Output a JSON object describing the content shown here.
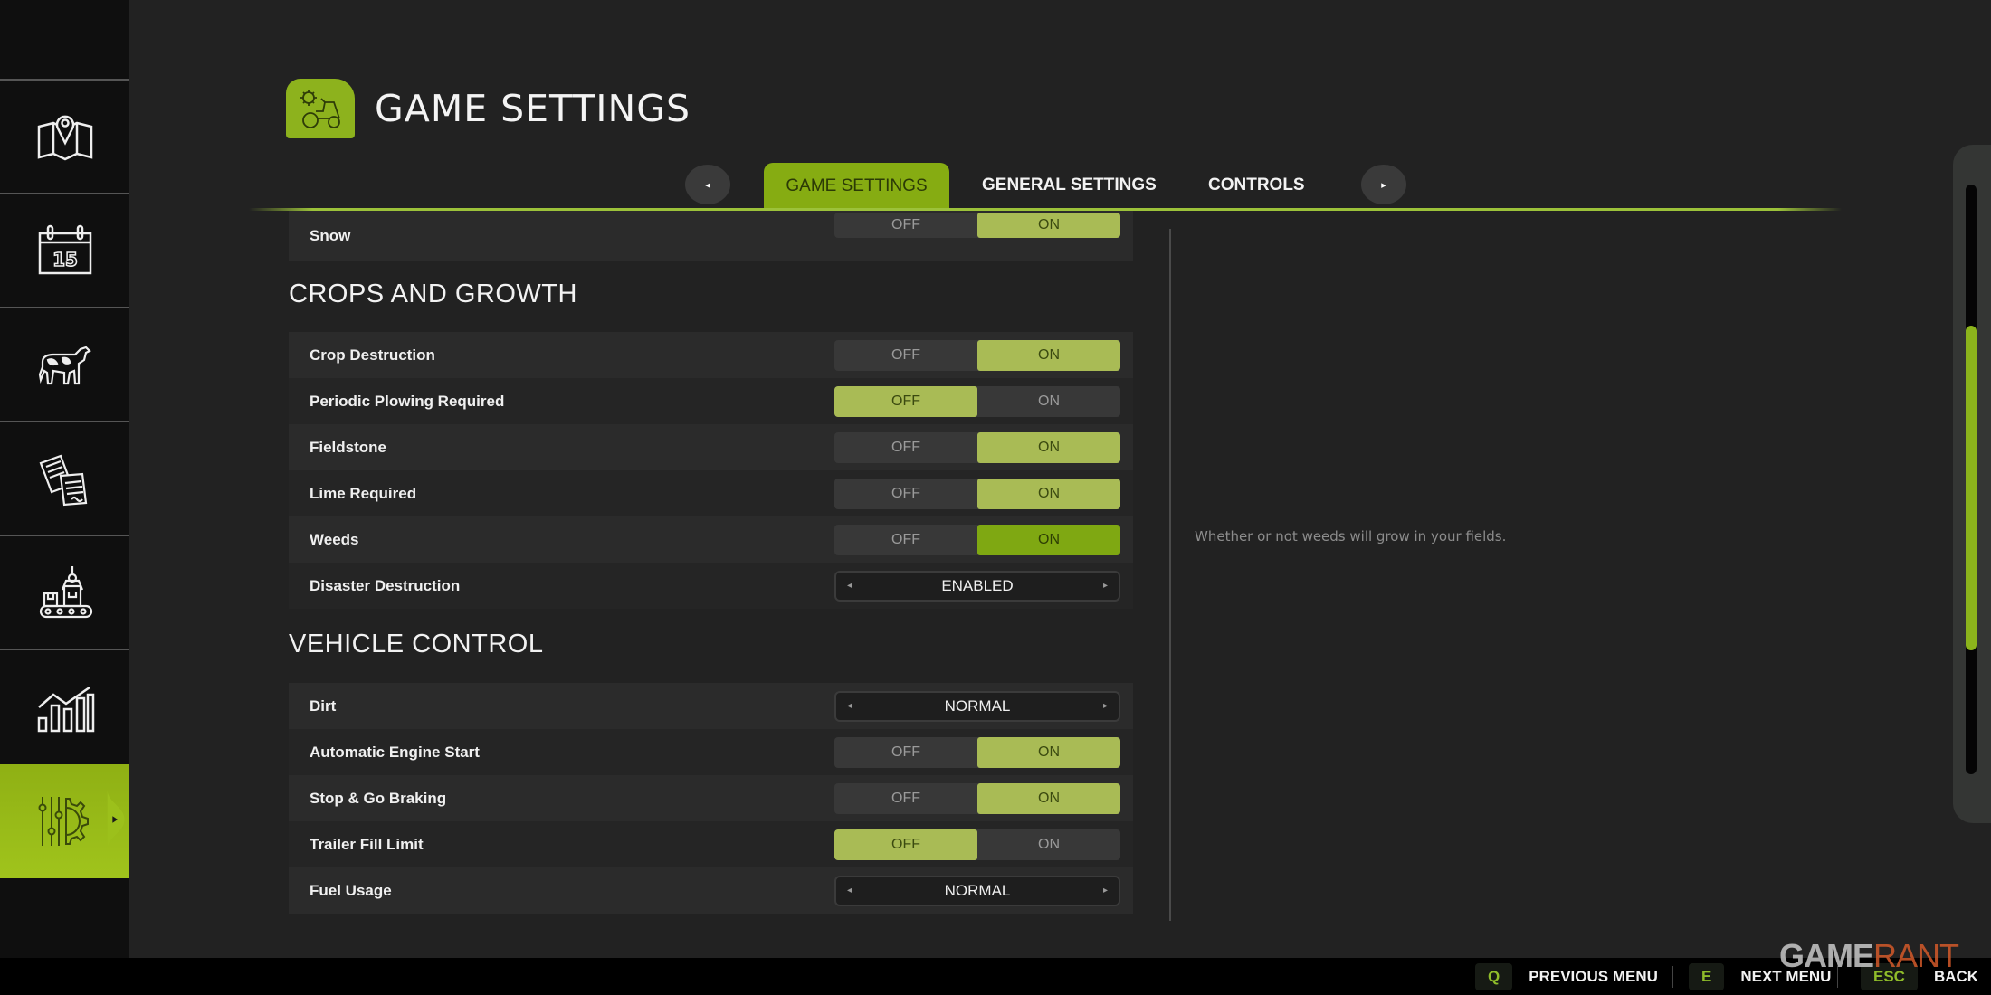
{
  "sidebar": {
    "items": [
      {
        "name": "map",
        "icon": "map-pin-icon"
      },
      {
        "name": "calendar",
        "icon": "calendar-icon",
        "day": "15"
      },
      {
        "name": "animals",
        "icon": "cow-icon"
      },
      {
        "name": "contracts",
        "icon": "documents-icon"
      },
      {
        "name": "production",
        "icon": "production-icon"
      },
      {
        "name": "statistics",
        "icon": "chart-icon"
      },
      {
        "name": "settings",
        "icon": "settings-sliders-gear-icon",
        "active": true
      }
    ]
  },
  "header": {
    "title": "GAME SETTINGS",
    "icon": "tractor-gear-icon"
  },
  "tabs": {
    "items": [
      {
        "label": "GAME SETTINGS",
        "active": true
      },
      {
        "label": "GENERAL SETTINGS",
        "active": false
      },
      {
        "label": "CONTROLS",
        "active": false
      }
    ],
    "prev_icon": "◂",
    "next_icon": "▸"
  },
  "settings": {
    "partial_row": {
      "label": "Snow",
      "type": "toggle",
      "value": "ON"
    },
    "sections": [
      {
        "title": "CROPS AND GROWTH",
        "rows": [
          {
            "label": "Crop Destruction",
            "type": "toggle",
            "value": "ON"
          },
          {
            "label": "Periodic Plowing Required",
            "type": "toggle",
            "value": "OFF"
          },
          {
            "label": "Fieldstone",
            "type": "toggle",
            "value": "ON"
          },
          {
            "label": "Lime Required",
            "type": "toggle",
            "value": "ON"
          },
          {
            "label": "Weeds",
            "type": "toggle",
            "value": "ON",
            "focused": true
          },
          {
            "label": "Disaster Destruction",
            "type": "selector",
            "value": "ENABLED"
          }
        ]
      },
      {
        "title": "VEHICLE CONTROL",
        "rows": [
          {
            "label": "Dirt",
            "type": "selector",
            "value": "NORMAL"
          },
          {
            "label": "Automatic Engine Start",
            "type": "toggle",
            "value": "ON"
          },
          {
            "label": "Stop & Go Braking",
            "type": "toggle",
            "value": "ON"
          },
          {
            "label": "Trailer Fill Limit",
            "type": "toggle",
            "value": "OFF"
          },
          {
            "label": "Fuel Usage",
            "type": "selector",
            "value": "NORMAL"
          }
        ]
      }
    ],
    "toggle_labels": {
      "off": "OFF",
      "on": "ON"
    },
    "selector_arrows": {
      "left": "◂",
      "right": "▸"
    }
  },
  "description": "Whether or not weeds will grow in your fields.",
  "scrollbar": {
    "position_start": 0.24,
    "position_end": 0.79
  },
  "footer": {
    "hints": [
      {
        "key": "Q",
        "label": "PREVIOUS MENU"
      },
      {
        "key": "E",
        "label": "NEXT MENU"
      },
      {
        "key": "ESC",
        "label": "BACK"
      }
    ]
  },
  "watermark": {
    "part1": "GAME",
    "part2": "RANT"
  },
  "colors": {
    "accent": "#86ac12",
    "toggle_selected": "#a9bb55",
    "toggle_focused": "#7fa812",
    "sidebar_bg": "#0f0f0f",
    "page_bg": "#222222"
  }
}
